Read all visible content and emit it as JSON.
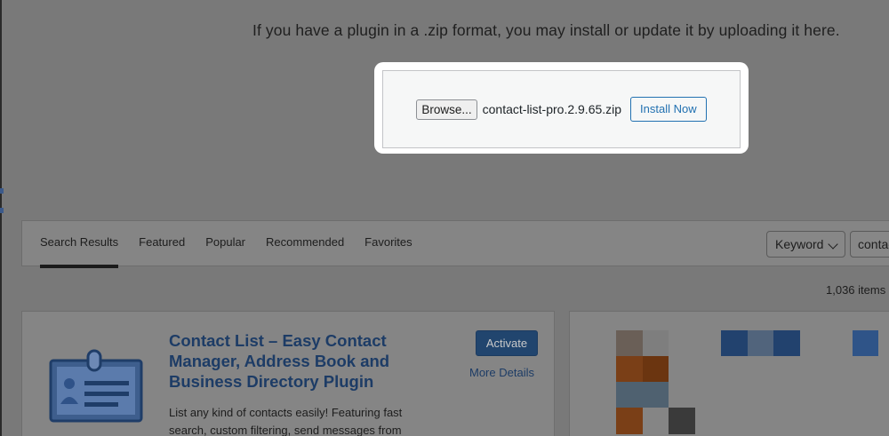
{
  "upload": {
    "help_text": "If you have a plugin in a .zip format, you may install or update it by uploading it here.",
    "browse_label": "Browse...",
    "file_name": "contact-list-pro.2.9.65.zip",
    "install_label": "Install Now"
  },
  "filter_bar": {
    "tabs": [
      {
        "label": "Search Results",
        "active": true
      },
      {
        "label": "Featured",
        "active": false
      },
      {
        "label": "Popular",
        "active": false
      },
      {
        "label": "Recommended",
        "active": false
      },
      {
        "label": "Favorites",
        "active": false
      }
    ],
    "search_type": "Keyword",
    "search_value": "contact"
  },
  "results": {
    "count_text": "1,036 items"
  },
  "plugins": [
    {
      "title": "Contact List – Easy Contact Manager, Address Book and Business Directory Plugin",
      "activate_label": "Activate",
      "more_details_label": "More Details",
      "description": "List any kind of contacts easily! Featuring fast search, custom filtering, send messages from",
      "icon": "id-card-icon"
    }
  ],
  "colors": {
    "overlay": "#797979",
    "link": "#1d3c66",
    "primary_button": "#21456e",
    "highlight_box": "#ffffff"
  }
}
